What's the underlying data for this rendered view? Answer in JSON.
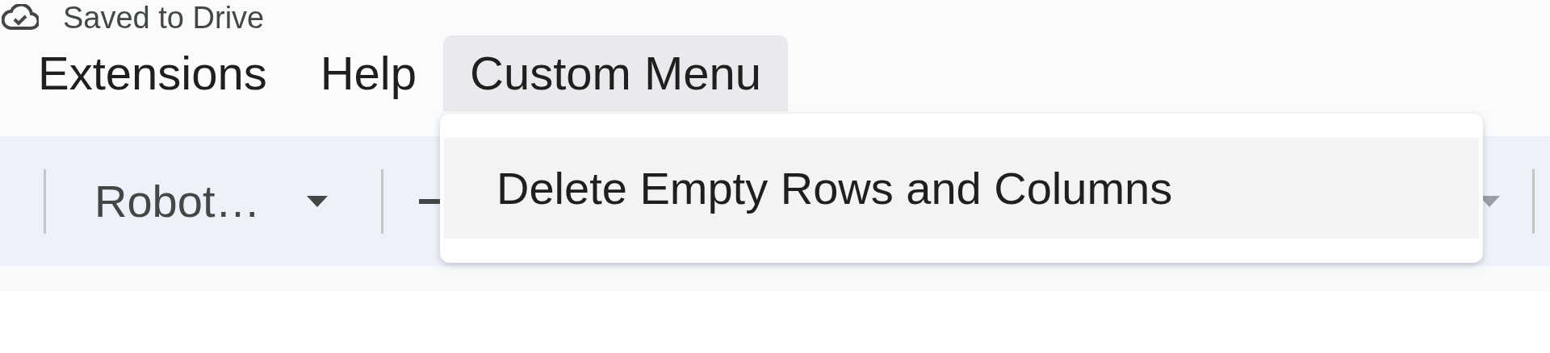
{
  "status": {
    "text": "Saved to Drive"
  },
  "menu_bar": [
    {
      "label": "Extensions",
      "selected": false
    },
    {
      "label": "Help",
      "selected": false
    },
    {
      "label": "Custom Menu",
      "selected": true
    }
  ],
  "toolbar": {
    "font_select": {
      "value": "Robot…"
    }
  },
  "dropdown": {
    "items": [
      {
        "label": "Delete Empty Rows and Columns",
        "selected": true
      }
    ]
  }
}
